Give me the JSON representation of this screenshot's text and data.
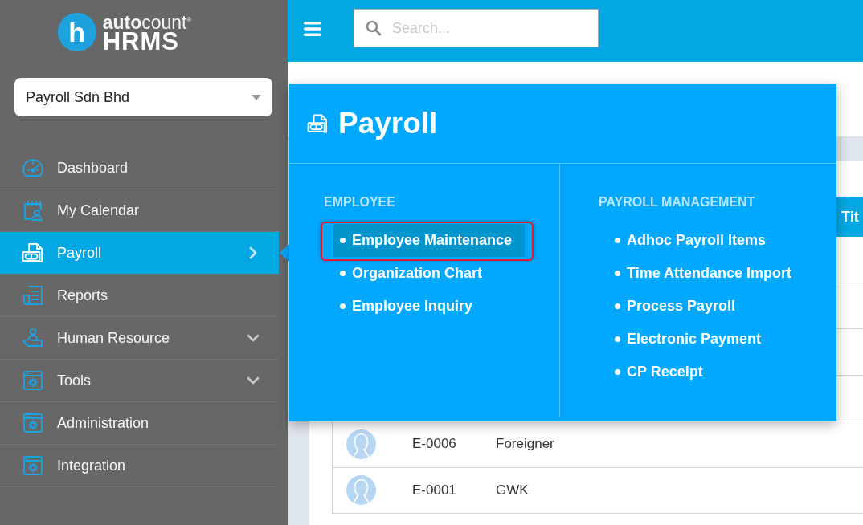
{
  "logo": {
    "mark": "h",
    "brand": "**auto**count$^{®}$",
    "product": "HRMS"
  },
  "company_select": {
    "value": "Payroll Sdn Bhd"
  },
  "sidebar": {
    "items": [
      {
        "label": "Dashboard",
        "kind": "link",
        "selected": false
      },
      {
        "label": "My Calendar",
        "kind": "link",
        "selected": false
      },
      {
        "label": "Payroll",
        "kind": "flyout",
        "selected": true
      },
      {
        "label": "Reports",
        "kind": "link",
        "selected": false
      },
      {
        "label": "Human Resource",
        "kind": "group",
        "selected": false
      },
      {
        "label": "Tools",
        "kind": "group",
        "selected": false
      },
      {
        "label": "Administration",
        "kind": "link",
        "selected": false
      },
      {
        "label": "Integration",
        "kind": "link",
        "selected": false
      }
    ]
  },
  "topbar": {
    "search": {
      "placeholder": "Search..."
    }
  },
  "table": {
    "columns": [
      {
        "label": "Tit"
      }
    ],
    "rows": [
      {
        "code": "E-0006",
        "name": "Foreigner"
      },
      {
        "code": "E-0001",
        "name": "GWK"
      }
    ]
  },
  "flyout": {
    "title": "Payroll",
    "sections": [
      {
        "heading": "EMPLOYEE",
        "items": [
          {
            "label": "Employee Maintenance",
            "selected": true,
            "annotated": true
          },
          {
            "label": "Organization Chart",
            "selected": false,
            "annotated": false
          },
          {
            "label": "Employee Inquiry",
            "selected": false,
            "annotated": false
          }
        ]
      },
      {
        "heading": "PAYROLL MANAGEMENT",
        "items": [
          {
            "label": "Adhoc Payroll Items",
            "selected": false,
            "annotated": false
          },
          {
            "label": "Time Attendance Import",
            "selected": false,
            "annotated": false
          },
          {
            "label": "Process Payroll",
            "selected": false,
            "annotated": false
          },
          {
            "label": "Electronic Payment",
            "selected": false,
            "annotated": false
          },
          {
            "label": "CP Receipt",
            "selected": false,
            "annotated": false
          }
        ]
      }
    ]
  }
}
